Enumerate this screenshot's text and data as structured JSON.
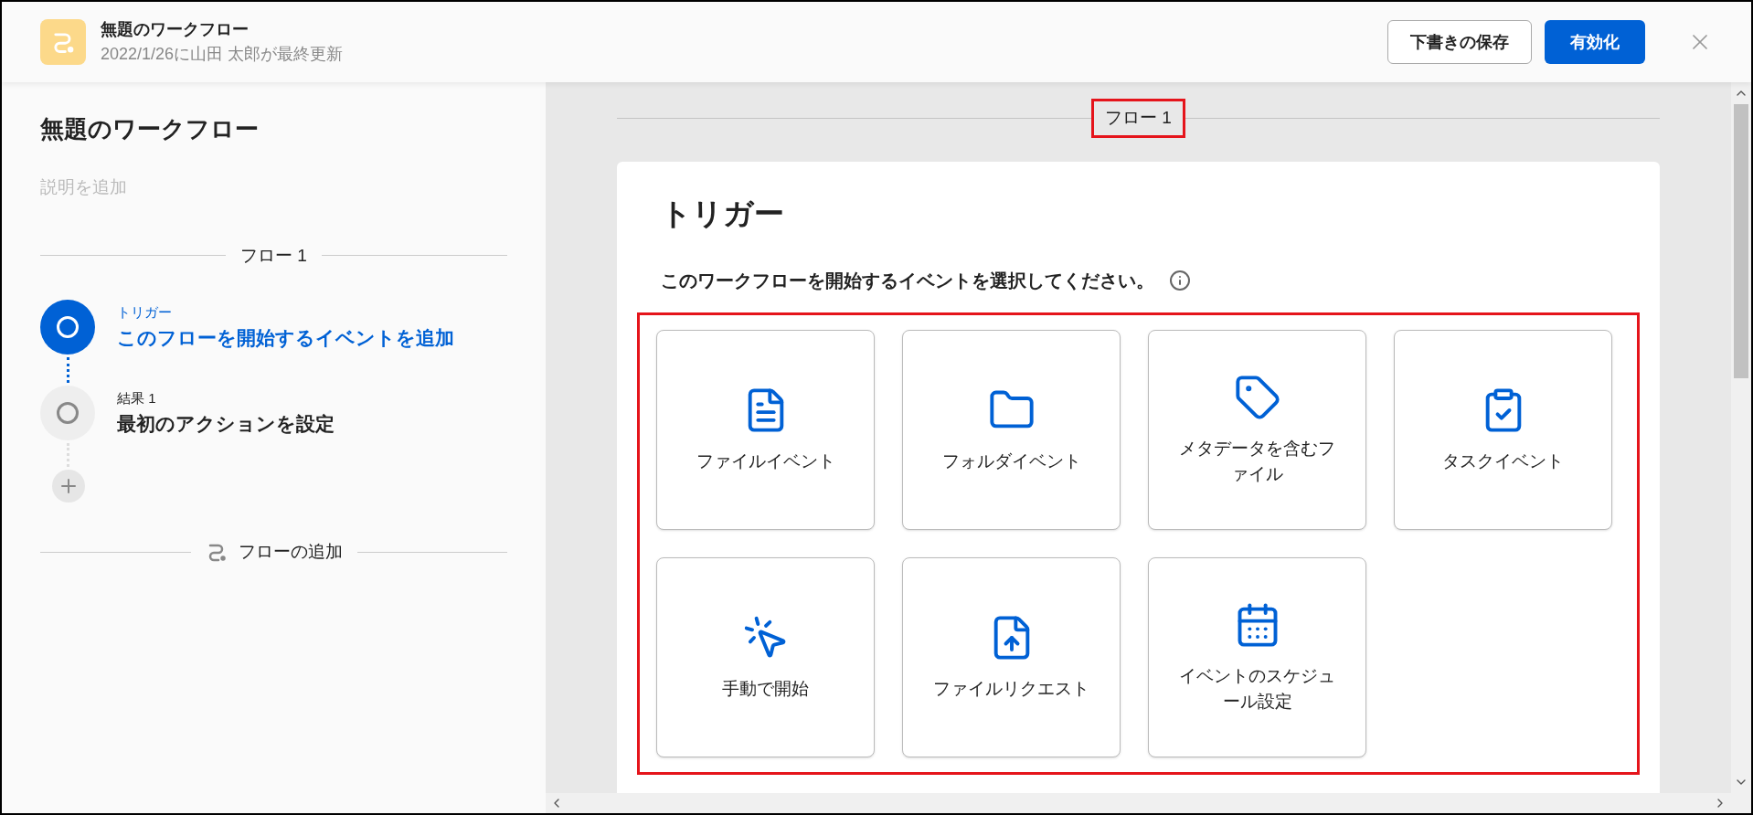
{
  "header": {
    "title": "無題のワークフロー",
    "subtitle": "2022/1/26に山田 太郎が最終更新",
    "buttons": [
      {
        "label": "下書きの保存",
        "kind": "secondary"
      },
      {
        "label": "有効化",
        "kind": "primary"
      }
    ]
  },
  "sidebar": {
    "title": "無題のワークフロー",
    "description_placeholder": "説明を追加",
    "flow_label": "フロー 1",
    "steps": [
      {
        "caption": "トリガー",
        "text": "このフローを開始するイベントを追加",
        "selected": true
      },
      {
        "caption": "結果 1",
        "text": "最初のアクションを設定",
        "selected": false
      }
    ],
    "add_flow": "フローの追加"
  },
  "canvas": {
    "flow_label": "フロー 1",
    "card_title": "トリガー",
    "prompt": "このワークフローを開始するイベントを選択してください。",
    "options": [
      {
        "label": "ファイルイベント",
        "kind": "file"
      },
      {
        "label": "フォルダイベント",
        "kind": "folder"
      },
      {
        "label": "メタデータを含むファイル",
        "kind": "metadata"
      },
      {
        "label": "タスクイベント",
        "kind": "task"
      },
      {
        "label": "手動で開始",
        "kind": "manual"
      },
      {
        "label": "ファイルリクエスト",
        "kind": "request"
      },
      {
        "label": "イベントのスケジュール設定",
        "kind": "schedule"
      }
    ]
  }
}
